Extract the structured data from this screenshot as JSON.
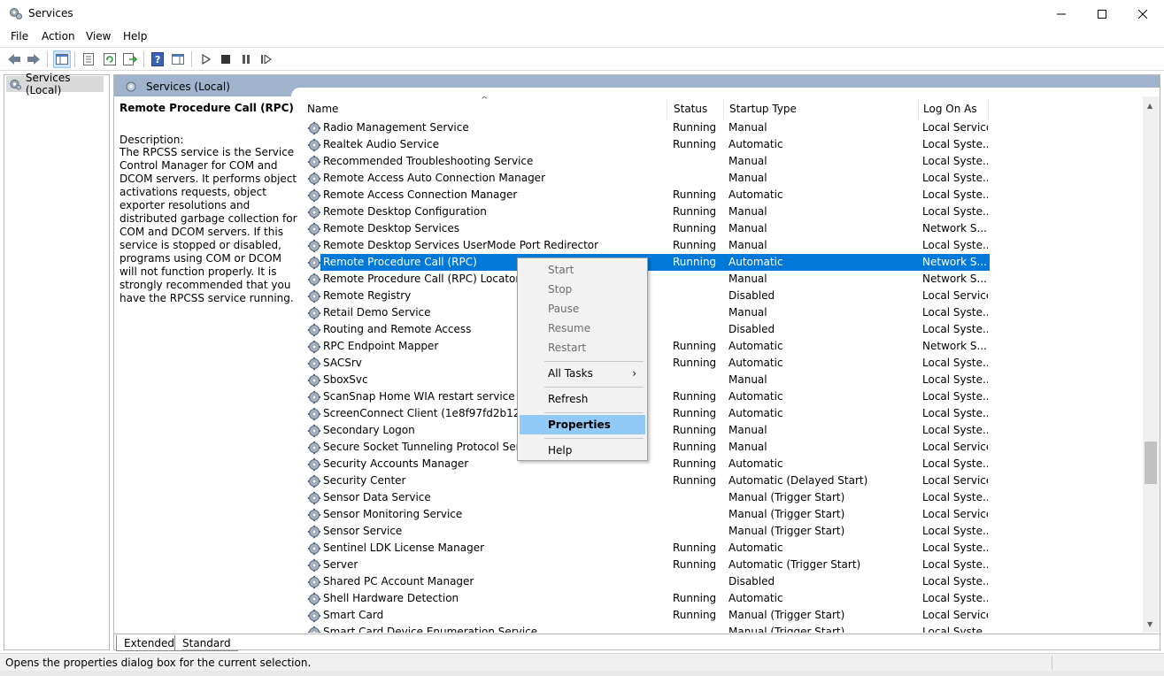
{
  "window": {
    "title": "Services"
  },
  "menus": [
    "File",
    "Action",
    "View",
    "Help"
  ],
  "tree": {
    "root_label": "Services (Local)"
  },
  "panel": {
    "title": "Services (Local)"
  },
  "description": {
    "service_name": "Remote Procedure Call (RPC)",
    "label": "Description:",
    "text": "The RPCSS service is the Service Control Manager for COM and DCOM servers. It performs object activations requests, object exporter resolutions and distributed garbage collection for COM and DCOM servers. If this service is stopped or disabled, programs using COM or DCOM will not function properly. It is strongly recommended that you have the RPCSS service running."
  },
  "columns": {
    "name": "Name",
    "status": "Status",
    "startup": "Startup Type",
    "logon": "Log On As"
  },
  "services": [
    {
      "name": "Radio Management Service",
      "status": "Running",
      "startup": "Manual",
      "logon": "Local Service"
    },
    {
      "name": "Realtek Audio Service",
      "status": "Running",
      "startup": "Automatic",
      "logon": "Local Syste..."
    },
    {
      "name": "Recommended Troubleshooting Service",
      "status": "",
      "startup": "Manual",
      "logon": "Local Syste..."
    },
    {
      "name": "Remote Access Auto Connection Manager",
      "status": "",
      "startup": "Manual",
      "logon": "Local Syste..."
    },
    {
      "name": "Remote Access Connection Manager",
      "status": "Running",
      "startup": "Automatic",
      "logon": "Local Syste..."
    },
    {
      "name": "Remote Desktop Configuration",
      "status": "Running",
      "startup": "Manual",
      "logon": "Local Syste..."
    },
    {
      "name": "Remote Desktop Services",
      "status": "Running",
      "startup": "Manual",
      "logon": "Network S..."
    },
    {
      "name": "Remote Desktop Services UserMode Port Redirector",
      "status": "Running",
      "startup": "Manual",
      "logon": "Local Syste..."
    },
    {
      "name": "Remote Procedure Call (RPC)",
      "status": "Running",
      "startup": "Automatic",
      "logon": "Network S...",
      "selected": true
    },
    {
      "name": "Remote Procedure Call (RPC) Locator",
      "status": "",
      "startup": "Manual",
      "logon": "Network S..."
    },
    {
      "name": "Remote Registry",
      "status": "",
      "startup": "Disabled",
      "logon": "Local Service"
    },
    {
      "name": "Retail Demo Service",
      "status": "",
      "startup": "Manual",
      "logon": "Local Syste..."
    },
    {
      "name": "Routing and Remote Access",
      "status": "",
      "startup": "Disabled",
      "logon": "Local Syste..."
    },
    {
      "name": "RPC Endpoint Mapper",
      "status": "Running",
      "startup": "Automatic",
      "logon": "Network S..."
    },
    {
      "name": "SACSrv",
      "status": "Running",
      "startup": "Automatic",
      "logon": "Local Syste..."
    },
    {
      "name": "SboxSvc",
      "status": "",
      "startup": "Manual",
      "logon": "Local Syste..."
    },
    {
      "name": "ScanSnap Home WIA restart service",
      "status": "Running",
      "startup": "Automatic",
      "logon": "Local Syste..."
    },
    {
      "name": "ScreenConnect Client (1e8f97fd2b122e61)",
      "status": "Running",
      "startup": "Automatic",
      "logon": "Local Syste..."
    },
    {
      "name": "Secondary Logon",
      "status": "Running",
      "startup": "Manual",
      "logon": "Local Syste..."
    },
    {
      "name": "Secure Socket Tunneling Protocol Service",
      "status": "Running",
      "startup": "Manual",
      "logon": "Local Service"
    },
    {
      "name": "Security Accounts Manager",
      "status": "Running",
      "startup": "Automatic",
      "logon": "Local Syste..."
    },
    {
      "name": "Security Center",
      "status": "Running",
      "startup": "Automatic (Delayed Start)",
      "logon": "Local Service"
    },
    {
      "name": "Sensor Data Service",
      "status": "",
      "startup": "Manual (Trigger Start)",
      "logon": "Local Syste..."
    },
    {
      "name": "Sensor Monitoring Service",
      "status": "",
      "startup": "Manual (Trigger Start)",
      "logon": "Local Service"
    },
    {
      "name": "Sensor Service",
      "status": "",
      "startup": "Manual (Trigger Start)",
      "logon": "Local Syste..."
    },
    {
      "name": "Sentinel LDK License Manager",
      "status": "Running",
      "startup": "Automatic",
      "logon": "Local Syste..."
    },
    {
      "name": "Server",
      "status": "Running",
      "startup": "Automatic (Trigger Start)",
      "logon": "Local Syste..."
    },
    {
      "name": "Shared PC Account Manager",
      "status": "",
      "startup": "Disabled",
      "logon": "Local Syste..."
    },
    {
      "name": "Shell Hardware Detection",
      "status": "Running",
      "startup": "Automatic",
      "logon": "Local Syste..."
    },
    {
      "name": "Smart Card",
      "status": "Running",
      "startup": "Manual (Trigger Start)",
      "logon": "Local Service"
    },
    {
      "name": "Smart Card Device Enumeration Service",
      "status": "",
      "startup": "Manual (Trigger Start)",
      "logon": "Local Syste..."
    }
  ],
  "context_menu": {
    "start": "Start",
    "stop": "Stop",
    "pause": "Pause",
    "resume": "Resume",
    "restart": "Restart",
    "all_tasks": "All Tasks",
    "refresh": "Refresh",
    "properties": "Properties",
    "help": "Help"
  },
  "tabs": {
    "extended": "Extended",
    "standard": "Standard"
  },
  "status_bar": {
    "text": "Opens the properties dialog box for the current selection."
  },
  "colors": {
    "selection": "#0078d7",
    "panel_header": "#9fb4cc",
    "menu_hover": "#91c9f7"
  }
}
